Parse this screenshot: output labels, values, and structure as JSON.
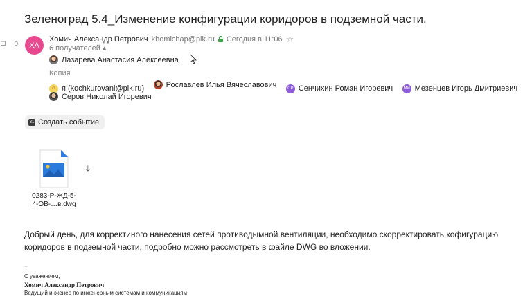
{
  "email": {
    "subject": "Зеленоград 5.4_Изменение конфигурации коридоров в подземной части.",
    "sender": {
      "initials": "ХА",
      "name": "Хомич Александр Петрович",
      "email": "khomichap@pik.ru",
      "date": "Сегодня в 11:06"
    },
    "recipients_count": "6 получателей ▴",
    "to": [
      {
        "name": "Лазарева Анастасия Алексеевна"
      }
    ],
    "copy_label": "Копия",
    "cc": [
      {
        "name": "я (kochkurovani@pik.ru)"
      },
      {
        "name": "Рославлев Илья Вячеславович"
      },
      {
        "name": "Сенчихин Роман Игоревич",
        "initials": "СР"
      },
      {
        "name": "Мезенцев Игорь Дмитриевич",
        "initials": "МИ"
      },
      {
        "name": "Серов Николай Игоревич"
      }
    ],
    "create_event_label": "Создать событие",
    "calendar_day": "31",
    "attachment": {
      "name_line1": "0283-Р-ЖД-5-",
      "name_line2": "4-ОВ-…в.dwg"
    },
    "body": "Добрый день, для корректиного нанесения сетей противодымной вентиляции, необходимо скорректировать кофигурацию коридоров в подземной части, подробно можно рассмотреть в файле DWG во вложении.",
    "signature": {
      "dashes": "--",
      "regards": "С уважением,",
      "name": "Хомич Александр Петрович",
      "position": "Ведущий инженер по инженерным системам и коммуникациям"
    }
  },
  "colors": {
    "avatar": "#e8488e",
    "accent_purple": "#8e5bd8",
    "lock_green": "#3aa64a",
    "file_blue": "#2b7bdc"
  },
  "icons": {
    "side": "⊐ o",
    "star": "☆",
    "lock": "🔒",
    "download": "⤓"
  }
}
